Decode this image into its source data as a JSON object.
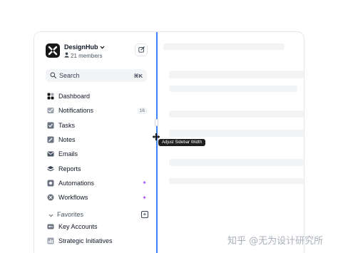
{
  "workspace": {
    "name": "DesignHub",
    "members": "21 members"
  },
  "search": {
    "label": "Search",
    "shortcut": "⌘K"
  },
  "nav": [
    {
      "label": "Dashboard",
      "icon": "dashboard-icon"
    },
    {
      "label": "Notifications",
      "icon": "bell-icon",
      "badge": "16"
    },
    {
      "label": "Tasks",
      "icon": "check-square-icon"
    },
    {
      "label": "Notes",
      "icon": "note-icon"
    },
    {
      "label": "Emails",
      "icon": "mail-icon"
    },
    {
      "label": "Reports",
      "icon": "stack-icon"
    },
    {
      "label": "Automations",
      "icon": "automation-icon",
      "sparkle": "✦"
    },
    {
      "label": "Workflows",
      "icon": "workflow-icon",
      "sparkle": "✦"
    }
  ],
  "favorites": {
    "label": "Favorites",
    "items": [
      {
        "label": "Key Accounts",
        "icon": "key-icon"
      },
      {
        "label": "Strategic Initiatives",
        "icon": "chart-icon"
      }
    ]
  },
  "tooltip": "Adjust Sidebar Width",
  "watermark": "知乎 @无为设计研究所",
  "colors": {
    "accent": "#3b82f6",
    "sparkle": "#a855f7",
    "skeleton": "#f1f3f5"
  }
}
